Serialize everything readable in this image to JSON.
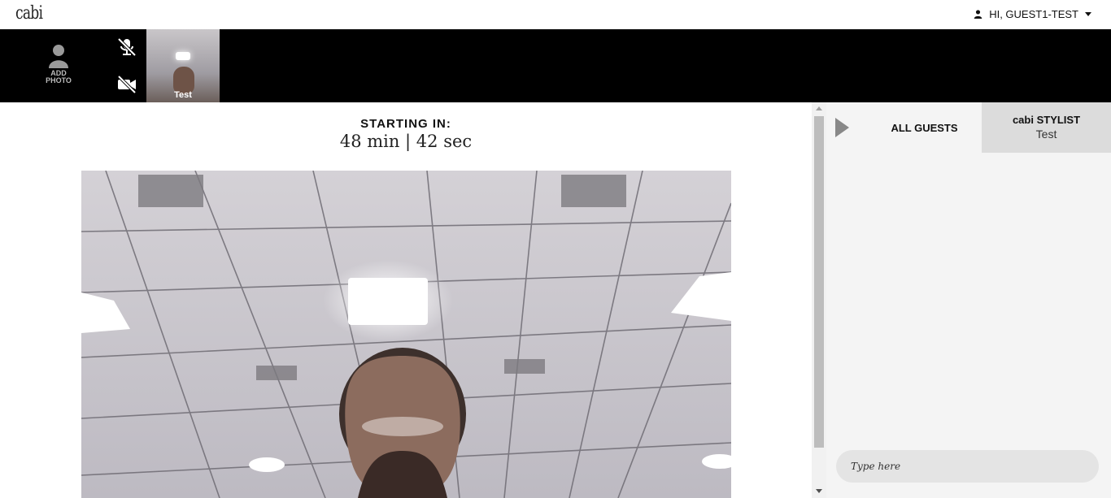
{
  "header": {
    "logo": "cabi",
    "greeting": "HI, GUEST1-TEST"
  },
  "toolbar": {
    "add_photo_line1": "ADD",
    "add_photo_line2": "PHOTO",
    "self_view_name": "Test"
  },
  "main": {
    "starting_label": "STARTING IN:",
    "countdown": "48 min | 42 sec"
  },
  "chat": {
    "tab_all_guests": "ALL GUESTS",
    "tab_stylist_title": "cabi STYLIST",
    "tab_stylist_name": "Test",
    "input_placeholder": "Type here"
  },
  "icons": [
    "person-icon",
    "chevron-down-icon",
    "avatar-placeholder-icon",
    "mic-muted-icon",
    "camera-off-icon",
    "collapse-arrow-icon"
  ],
  "colors": {
    "strip_background": "#000000",
    "chat_background": "#f4f4f4",
    "active_tab_background": "#dcdcdc"
  }
}
